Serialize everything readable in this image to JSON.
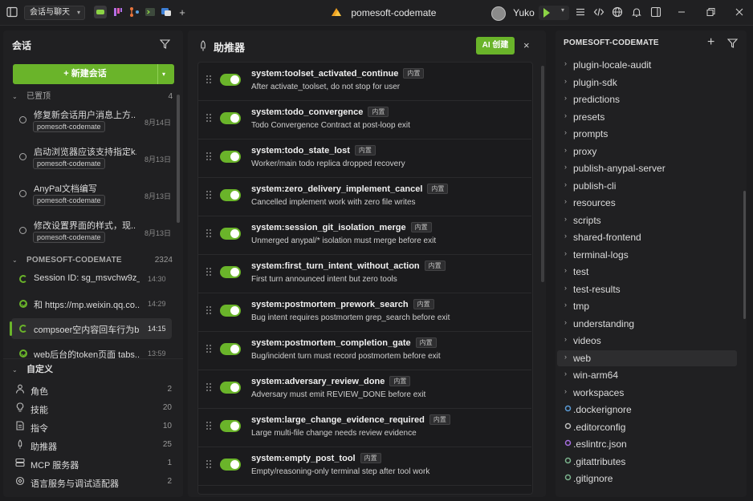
{
  "titlebar": {
    "workspace_label": "会话与聊天",
    "window_title": "pomesoft-codemate",
    "user_name": "Yuko",
    "icons": [
      "sidebar-toggle-icon",
      "app-chat-icon",
      "app-kanban-icon",
      "app-branch-icon",
      "app-terminal-icon",
      "app-layers-icon",
      "add-tab-icon",
      "menu-icon",
      "code-icon",
      "globe-icon",
      "bell-icon",
      "split-pane-icon",
      "minimize-icon",
      "restore-icon",
      "close-icon"
    ]
  },
  "left": {
    "header": "会话",
    "new_chat": "+ 新建会话",
    "pinned": {
      "label": "已置顶",
      "count": "4",
      "items": [
        {
          "title": "修复新会话用户消息上方...",
          "tag": "pomesoft-codemate",
          "date": "8月14日"
        },
        {
          "title": "启动浏览器应该支持指定k...",
          "tag": "pomesoft-codemate",
          "date": "8月13日"
        },
        {
          "title": "AnyPal文档编写",
          "tag": "pomesoft-codemate",
          "date": "8月13日"
        },
        {
          "title": "修改设置界面的样式，现...",
          "tag": "pomesoft-codemate",
          "date": "8月13日"
        }
      ]
    },
    "project": {
      "label": "POMESOFT-CODEMATE",
      "count": "2324",
      "sessions": [
        {
          "title": "Session ID: sg_msvchw9z_...",
          "time": "14:30",
          "status": "running"
        },
        {
          "title": "和 https://mp.weixin.qq.co...",
          "time": "14:29",
          "status": "done"
        },
        {
          "title": "compsoer空内容回车行为b...",
          "time": "14:15",
          "status": "running"
        },
        {
          "title": "web后台的token页面 tabs...",
          "time": "13:59",
          "status": "done"
        }
      ]
    },
    "custom": {
      "label": "自定义",
      "items": [
        {
          "label": "角色",
          "count": "2",
          "icon": "user-icon"
        },
        {
          "label": "技能",
          "count": "20",
          "icon": "lightbulb-icon"
        },
        {
          "label": "指令",
          "count": "10",
          "icon": "document-icon"
        },
        {
          "label": "助推器",
          "count": "25",
          "icon": "rocket-icon"
        },
        {
          "label": "MCP 服务器",
          "count": "1",
          "icon": "server-icon"
        },
        {
          "label": "语言服务与调试适配器",
          "count": "2",
          "icon": "plug-icon"
        }
      ]
    }
  },
  "center": {
    "title": "助推器",
    "ai_button": "AI 创建",
    "close": "×",
    "badge": "内置",
    "rules": [
      {
        "name": "system:toolset_activated_continue",
        "desc": "After activate_toolset, do not stop for user",
        "enabled": true
      },
      {
        "name": "system:todo_convergence",
        "desc": "Todo Convergence Contract at post-loop exit",
        "enabled": true
      },
      {
        "name": "system:todo_state_lost",
        "desc": "Worker/main todo replica dropped recovery",
        "enabled": true
      },
      {
        "name": "system:zero_delivery_implement_cancel",
        "desc": "Cancelled implement work with zero file writes",
        "enabled": true
      },
      {
        "name": "system:session_git_isolation_merge",
        "desc": "Unmerged anypal/* isolation must merge before exit",
        "enabled": true
      },
      {
        "name": "system:first_turn_intent_without_action",
        "desc": "First turn announced intent but zero tools",
        "enabled": true
      },
      {
        "name": "system:postmortem_prework_search",
        "desc": "Bug intent requires postmortem grep_search before exit",
        "enabled": true
      },
      {
        "name": "system:postmortem_completion_gate",
        "desc": "Bug/incident turn must record postmortem before exit",
        "enabled": true
      },
      {
        "name": "system:adversary_review_done",
        "desc": "Adversary must emit REVIEW_DONE before exit",
        "enabled": true
      },
      {
        "name": "system:large_change_evidence_required",
        "desc": "Large multi-file change needs review evidence",
        "enabled": true
      },
      {
        "name": "system:empty_post_tool",
        "desc": "Empty/reasoning-only terminal step after tool work",
        "enabled": true
      }
    ]
  },
  "right": {
    "title": "POMESOFT-CODEMATE",
    "selected": "web",
    "folders": [
      "plugin-locale-audit",
      "plugin-sdk",
      "predictions",
      "presets",
      "prompts",
      "proxy",
      "publish-anypal-server",
      "publish-cli",
      "resources",
      "scripts",
      "shared-frontend",
      "terminal-logs",
      "test",
      "test-results",
      "tmp",
      "understanding",
      "videos",
      "web",
      "win-arm64",
      "workspaces"
    ],
    "files": [
      {
        "name": ".dockerignore",
        "icon": "docker-icon",
        "color": "#5a9bd5"
      },
      {
        "name": ".editorconfig",
        "icon": "config-icon",
        "color": "#bdbdbd"
      },
      {
        "name": ".eslintrc.json",
        "icon": "eslint-icon",
        "color": "#a66ee0"
      },
      {
        "name": ".gitattributes",
        "icon": "git-icon",
        "color": "#7bb38d"
      },
      {
        "name": ".gitignore",
        "icon": "git-icon",
        "color": "#7bb38d"
      }
    ]
  }
}
